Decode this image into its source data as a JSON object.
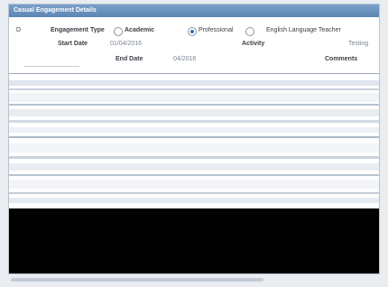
{
  "window": {
    "title": "Casual Engagement Details"
  },
  "engagement": {
    "type_label": "Engagement Type",
    "options": [
      {
        "label": "Academic",
        "selected": false
      },
      {
        "label": "Professional",
        "selected": true
      },
      {
        "label": "English Language Teacher",
        "selected": false
      }
    ],
    "start_label": "Start Date",
    "start_value": "01/04/2016",
    "activity_label": "Activity",
    "activity_value": "Testing",
    "end_label": "End Date",
    "end_value": "04/2016",
    "comments_label": "Comments"
  }
}
